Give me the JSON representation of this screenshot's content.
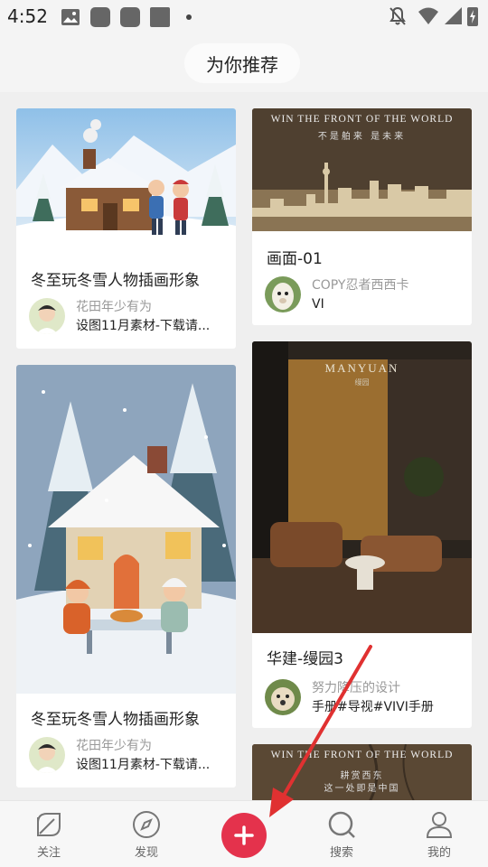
{
  "status_bar": {
    "time": "4:52"
  },
  "header": {
    "title": "为你推荐"
  },
  "feed": {
    "cards": [
      {
        "title": "冬至玩冬雪人物插画形象",
        "author": "花田年少有为",
        "desc": "设图11月素材-下载请..."
      },
      {
        "title": "画面-01",
        "author": "COPY忍者西西卡",
        "desc": "VI",
        "img_line1": "WIN THE FRONT OF THE WORLD",
        "img_line2": "不是舶来 是未来"
      },
      {
        "title": "冬至玩冬雪人物插画形象",
        "author": "花田年少有为",
        "desc": "设图11月素材-下载请..."
      },
      {
        "title": "华建-缦园3",
        "author": "努力降压的设计",
        "desc": "手册#导视#VIVI手册",
        "img_brand": "MANYUAN",
        "img_brand_cn": "缦园"
      },
      {
        "img_line1": "WIN THE FRONT OF THE WORLD",
        "img_line2": "耕赏西东",
        "img_line3": "这一处即是中国"
      }
    ]
  },
  "bottom_nav": {
    "items": [
      {
        "label": "关注",
        "icon": "leaf-icon"
      },
      {
        "label": "发现",
        "icon": "compass-icon"
      },
      {
        "label": "搜索",
        "icon": "search-icon"
      },
      {
        "label": "我的",
        "icon": "profile-icon"
      }
    ],
    "add_icon": "plus-icon"
  },
  "colors": {
    "accent": "#e4324c",
    "annotation_arrow": "#e03131"
  }
}
